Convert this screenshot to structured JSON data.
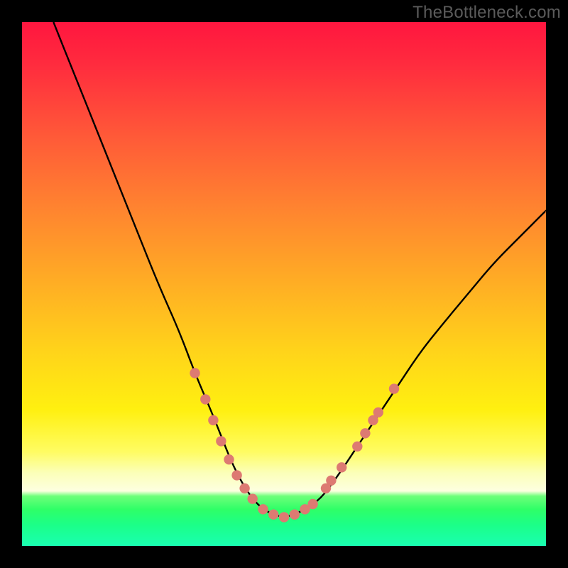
{
  "watermark": "TheBottleneck.com",
  "chart_data": {
    "type": "line",
    "title": "",
    "xlabel": "",
    "ylabel": "",
    "xlim": [
      0,
      100
    ],
    "ylim": [
      0,
      100
    ],
    "grid": false,
    "legend": false,
    "series": [
      {
        "name": "bottleneck-curve",
        "color": "#000000",
        "x": [
          6,
          10,
          14,
          18,
          22,
          26,
          30,
          33,
          36,
          38,
          40,
          42,
          44,
          46,
          48,
          50,
          52,
          54,
          57,
          60,
          64,
          68,
          72,
          76,
          80,
          85,
          90,
          95,
          100
        ],
        "y": [
          100,
          90,
          80,
          70,
          60,
          50,
          41,
          33,
          26,
          21,
          16,
          12,
          9,
          7,
          6,
          5.5,
          6,
          7,
          9,
          13,
          19,
          25,
          31,
          37,
          42,
          48,
          54,
          59,
          64
        ]
      }
    ],
    "markers": [
      {
        "name": "highlight-dots",
        "color": "#dd7a72",
        "points": [
          {
            "x": 33,
            "y": 33
          },
          {
            "x": 35,
            "y": 28
          },
          {
            "x": 36.5,
            "y": 24
          },
          {
            "x": 38,
            "y": 20
          },
          {
            "x": 39.5,
            "y": 16.5
          },
          {
            "x": 41,
            "y": 13.5
          },
          {
            "x": 42.5,
            "y": 11
          },
          {
            "x": 44,
            "y": 9
          },
          {
            "x": 46,
            "y": 7
          },
          {
            "x": 48,
            "y": 6
          },
          {
            "x": 50,
            "y": 5.5
          },
          {
            "x": 52,
            "y": 6
          },
          {
            "x": 54,
            "y": 7
          },
          {
            "x": 55.5,
            "y": 8
          },
          {
            "x": 58,
            "y": 11
          },
          {
            "x": 59,
            "y": 12.5
          },
          {
            "x": 61,
            "y": 15
          },
          {
            "x": 64,
            "y": 19
          },
          {
            "x": 65.5,
            "y": 21.5
          },
          {
            "x": 67,
            "y": 24
          },
          {
            "x": 68,
            "y": 25.5
          },
          {
            "x": 71,
            "y": 30
          }
        ]
      }
    ]
  }
}
